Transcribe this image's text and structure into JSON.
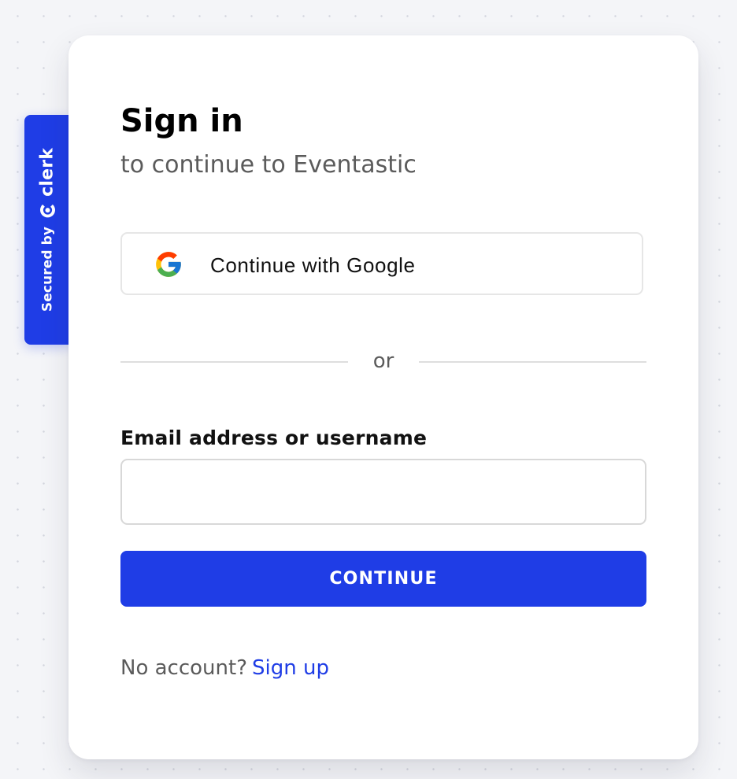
{
  "badge": {
    "secured_by": "Secured by",
    "brand": "clerk",
    "brand_icon": "clerk-logo-icon"
  },
  "card": {
    "title": "Sign in",
    "subtitle": "to continue to Eventastic",
    "google_button_label": "Continue with Google",
    "google_icon": "google-g-icon",
    "divider_text": "or",
    "email_label": "Email address or username",
    "email_value": "",
    "email_placeholder": "",
    "continue_label": "CONTINUE",
    "no_account_text": "No account?",
    "sign_up_label": "Sign up"
  },
  "colors": {
    "primary": "#1f3de6",
    "background": "#f4f5f8",
    "card": "#ffffff",
    "muted_text": "#5b5b5b",
    "border": "#e6e6e6"
  }
}
